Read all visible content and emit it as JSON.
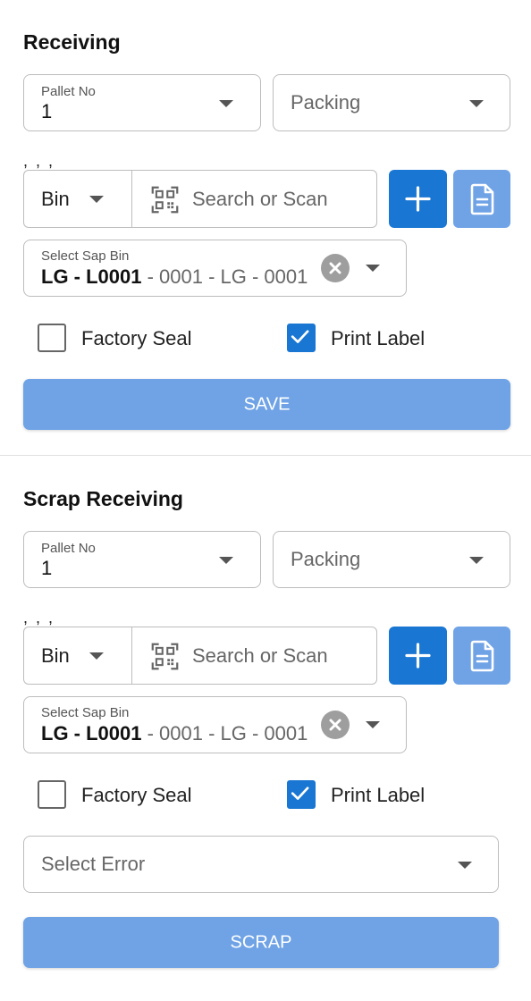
{
  "receiving": {
    "title": "Receiving",
    "pallet": {
      "label": "Pallet No",
      "value": "1"
    },
    "packing": {
      "placeholder": "Packing"
    },
    "commas": ", , ,",
    "bin": {
      "label": "Bin"
    },
    "search": {
      "placeholder": "Search or Scan"
    },
    "sap_bin": {
      "label": "Select Sap Bin",
      "value_bold": "LG - L0001",
      "value_rest": " - 0001 - LG - 0001"
    },
    "factory_seal": {
      "label": "Factory Seal",
      "checked": false
    },
    "print_label": {
      "label": "Print Label",
      "checked": true
    },
    "save_label": "SAVE"
  },
  "scrap": {
    "title": "Scrap Receiving",
    "pallet": {
      "label": "Pallet No",
      "value": "1"
    },
    "packing": {
      "placeholder": "Packing"
    },
    "commas": ", , ,",
    "bin": {
      "label": "Bin"
    },
    "search": {
      "placeholder": "Search or Scan"
    },
    "sap_bin": {
      "label": "Select Sap Bin",
      "value_bold": "LG - L0001",
      "value_rest": " - 0001 - LG - 0001"
    },
    "factory_seal": {
      "label": "Factory Seal",
      "checked": false
    },
    "print_label": {
      "label": "Print Label",
      "checked": true
    },
    "error": {
      "placeholder": "Select Error"
    },
    "scrap_label": "SCRAP"
  },
  "colors": {
    "primary": "#1976d2",
    "primary_light": "#6fa3e6",
    "border": "#bdbdbd"
  },
  "icons": [
    "chevron-down-icon",
    "qr-scan-icon",
    "plus-icon",
    "document-icon",
    "clear-icon",
    "checkmark-icon"
  ]
}
